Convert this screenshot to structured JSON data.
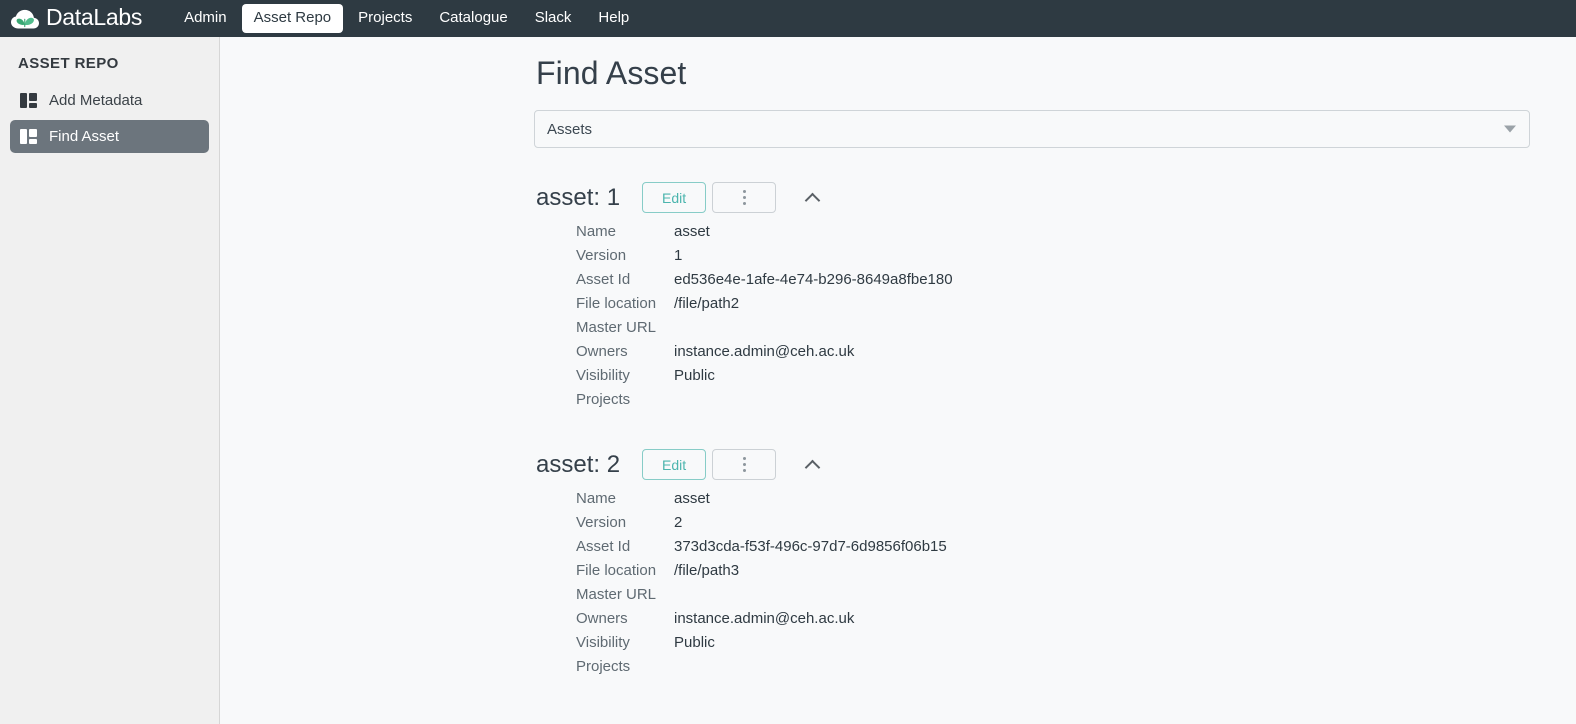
{
  "navbar": {
    "brand": "DataLabs",
    "brand_icon": "cloud-leaf-logo",
    "items": [
      {
        "label": "Admin",
        "active": false
      },
      {
        "label": "Asset Repo",
        "active": true
      },
      {
        "label": "Projects",
        "active": false
      },
      {
        "label": "Catalogue",
        "active": false
      },
      {
        "label": "Slack",
        "active": false
      },
      {
        "label": "Help",
        "active": false
      }
    ]
  },
  "sidebar": {
    "title": "ASSET REPO",
    "items": [
      {
        "label": "Add Metadata",
        "icon": "grid-icon",
        "active": false
      },
      {
        "label": "Find Asset",
        "icon": "grid-icon",
        "active": true
      }
    ]
  },
  "main": {
    "page_title": "Find Asset",
    "selector": {
      "value": "Assets",
      "caret_icon": "caret-down-icon"
    },
    "field_labels": {
      "name": "Name",
      "version": "Version",
      "asset_id": "Asset Id",
      "file_location": "File location",
      "master_url": "Master URL",
      "owners": "Owners",
      "visibility": "Visibility",
      "projects": "Projects"
    },
    "buttons": {
      "edit": "Edit",
      "menu_icon": "vertical-ellipsis-icon",
      "collapse_icon": "chevron-up-icon"
    },
    "assets": [
      {
        "heading": "asset: 1",
        "name": "asset",
        "version": "1",
        "asset_id": "ed536e4e-1afe-4e74-b296-8649a8fbe180",
        "file_location": "/file/path2",
        "master_url": "",
        "owners": "instance.admin@ceh.ac.uk",
        "visibility": "Public",
        "projects": ""
      },
      {
        "heading": "asset: 2",
        "name": "asset",
        "version": "2",
        "asset_id": "373d3cda-f53f-496c-97d7-6d9856f06b15",
        "file_location": "/file/path3",
        "master_url": "",
        "owners": "instance.admin@ceh.ac.uk",
        "visibility": "Public",
        "projects": ""
      }
    ]
  },
  "colors": {
    "navbar_bg": "#2e3a42",
    "sidebar_bg": "#f0f0f0",
    "sidebar_active_bg": "#6c757d",
    "content_bg": "#f8f9fa",
    "accent_teal": "#4cb5ae",
    "logo_green": "#4fb286"
  }
}
